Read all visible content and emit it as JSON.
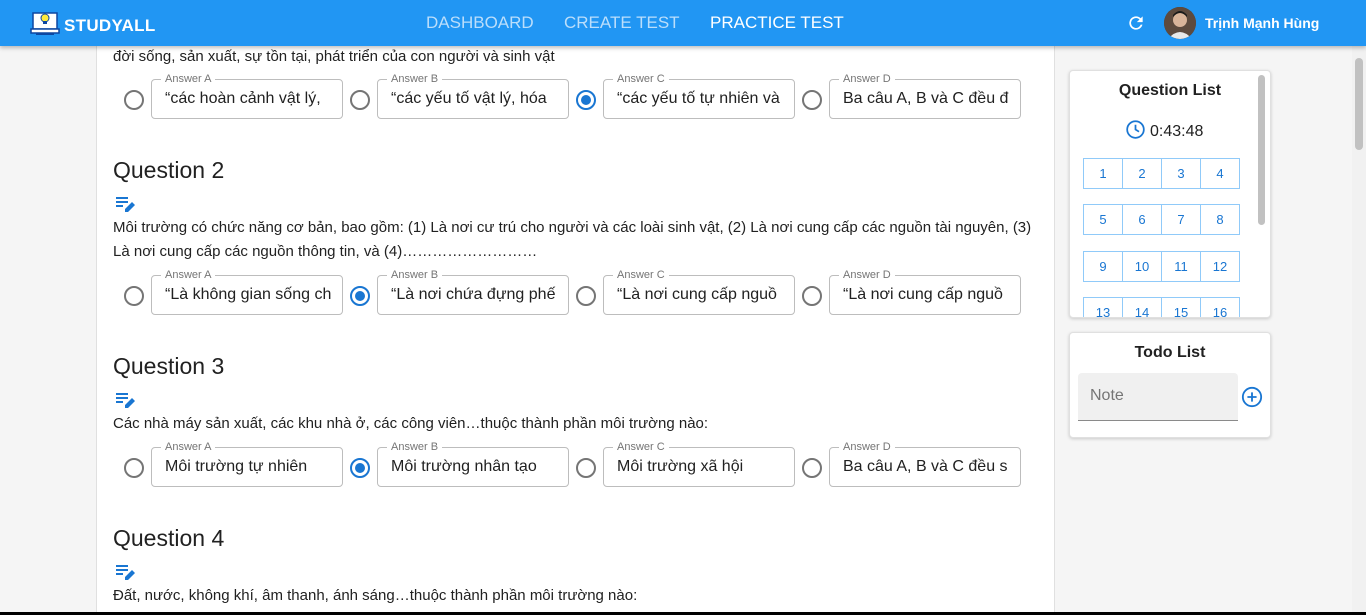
{
  "app": {
    "logo_text": "STUDYALL",
    "nav": [
      "DASHBOARD",
      "CREATE TEST",
      "PRACTICE TEST"
    ],
    "active_nav": "PRACTICE TEST",
    "user_name": "Trịnh Mạnh Hùng",
    "accent_color": "#2196f3"
  },
  "questions": [
    {
      "title": "",
      "text": "đời sống, sản xuất, sự tồn tại, phát triển của con người và sinh vật",
      "answers": [
        {
          "label": "Answer A",
          "value": "“các hoàn cảnh vật lý,",
          "checked": false
        },
        {
          "label": "Answer B",
          "value": "“các yếu tố vật lý, hóa",
          "checked": false
        },
        {
          "label": "Answer C",
          "value": "“các yếu tố tự nhiên và",
          "checked": true
        },
        {
          "label": "Answer D",
          "value": "Ba câu A, B và C đều đ",
          "checked": false
        }
      ]
    },
    {
      "title": "Question 2",
      "text": "Môi trường có chức năng cơ bản, bao gồm: (1) Là nơi cư trú cho người và các loài sinh vật, (2) Là nơi cung cấp các nguồn tài nguyên, (3) Là nơi cung cấp các nguồn thông tin, và (4)………………………",
      "answers": [
        {
          "label": "Answer A",
          "value": "“Là không gian sống ch",
          "checked": false
        },
        {
          "label": "Answer B",
          "value": "“Là nơi chứa đựng phế",
          "checked": true
        },
        {
          "label": "Answer C",
          "value": "“Là nơi cung cấp nguồ",
          "checked": false
        },
        {
          "label": "Answer D",
          "value": "“Là nơi cung cấp nguồ",
          "checked": false
        }
      ]
    },
    {
      "title": "Question 3",
      "text": "Các nhà máy sản xuất, các khu nhà ở, các công viên…thuộc thành phần môi trường nào:",
      "answers": [
        {
          "label": "Answer A",
          "value": "Môi trường tự nhiên",
          "checked": false
        },
        {
          "label": "Answer B",
          "value": "Môi trường nhân tạo",
          "checked": true
        },
        {
          "label": "Answer C",
          "value": "Môi trường xã hội",
          "checked": false
        },
        {
          "label": "Answer D",
          "value": "Ba câu A, B và C đều s",
          "checked": false
        }
      ]
    },
    {
      "title": "Question 4",
      "text": "Đất, nước, không khí, âm thanh, ánh sáng…thuộc thành phần môi trường nào:"
    }
  ],
  "sidebar": {
    "question_list_title": "Question List",
    "timer": "0:43:48",
    "numbers": [
      "1",
      "2",
      "3",
      "4",
      "5",
      "6",
      "7",
      "8",
      "9",
      "10",
      "11",
      "12",
      "13",
      "14",
      "15",
      "16"
    ],
    "todo_title": "Todo List",
    "note_placeholder": "Note"
  }
}
